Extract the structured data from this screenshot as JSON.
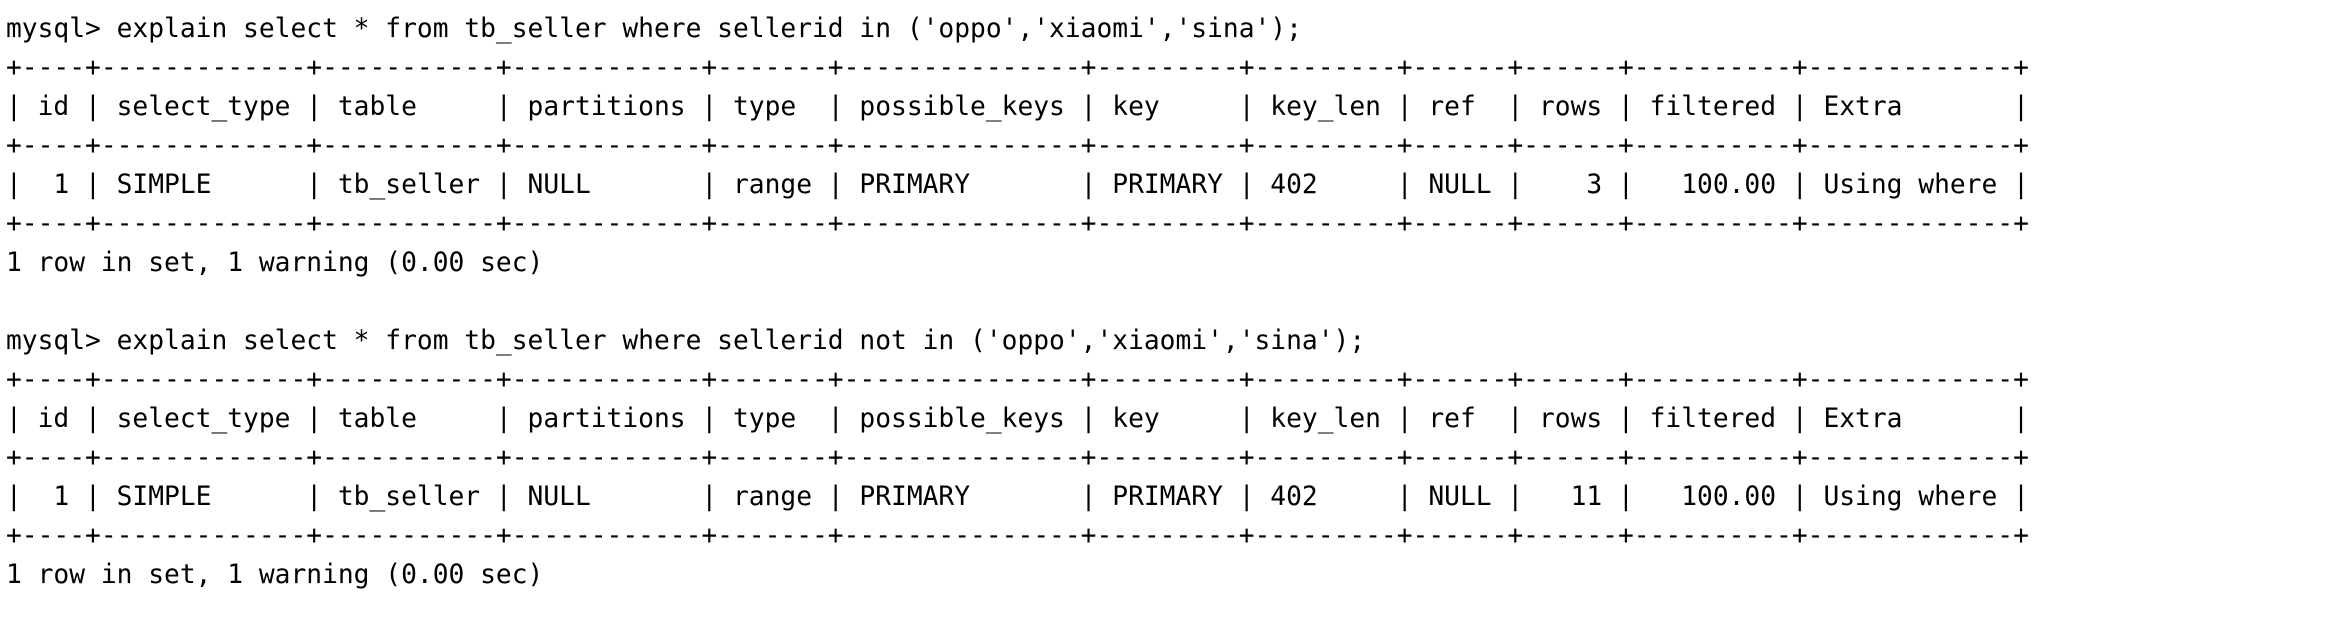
{
  "terminal": {
    "prompt": "mysql> ",
    "foreground_color": "#000000",
    "background_color": "#ffffff"
  },
  "statements": [
    {
      "prompt": "mysql> ",
      "query": "explain select * from tb_seller where sellerid in ('oppo','xiaomi','sina');",
      "command_line": "mysql> explain select * from tb_seller where sellerid in ('oppo','xiaomi','sina');",
      "border": "+----+-------------+-----------+------------+-------+---------------+---------+---------+------+------+----------+-------------+",
      "header_line": "| id | select_type | table     | partitions | type  | possible_keys | key     | key_len | ref  | rows | filtered | Extra       |",
      "row_line": "|  1 | SIMPLE      | tb_seller | NULL       | range | PRIMARY       | PRIMARY | 402     | NULL |    3 |   100.00 | Using where |",
      "status": "1 row in set, 1 warning (0.00 sec)",
      "columns": [
        "id",
        "select_type",
        "table",
        "partitions",
        "type",
        "possible_keys",
        "key",
        "key_len",
        "ref",
        "rows",
        "filtered",
        "Extra"
      ],
      "row": {
        "id": "1",
        "select_type": "SIMPLE",
        "table": "tb_seller",
        "partitions": "NULL",
        "type": "range",
        "possible_keys": "PRIMARY",
        "key": "PRIMARY",
        "key_len": "402",
        "ref": "NULL",
        "rows": "3",
        "filtered": "100.00",
        "Extra": "Using where"
      }
    },
    {
      "prompt": "mysql> ",
      "query": "explain select * from tb_seller where sellerid not in ('oppo','xiaomi','sina');",
      "command_line": "mysql> explain select * from tb_seller where sellerid not in ('oppo','xiaomi','sina');",
      "border": "+----+-------------+-----------+------------+-------+---------------+---------+---------+------+------+----------+-------------+",
      "header_line": "| id | select_type | table     | partitions | type  | possible_keys | key     | key_len | ref  | rows | filtered | Extra       |",
      "row_line": "|  1 | SIMPLE      | tb_seller | NULL       | range | PRIMARY       | PRIMARY | 402     | NULL |   11 |   100.00 | Using where |",
      "status": "1 row in set, 1 warning (0.00 sec)",
      "columns": [
        "id",
        "select_type",
        "table",
        "partitions",
        "type",
        "possible_keys",
        "key",
        "key_len",
        "ref",
        "rows",
        "filtered",
        "Extra"
      ],
      "row": {
        "id": "1",
        "select_type": "SIMPLE",
        "table": "tb_seller",
        "partitions": "NULL",
        "type": "range",
        "possible_keys": "PRIMARY",
        "key": "PRIMARY",
        "key_len": "402",
        "ref": "NULL",
        "rows": "11",
        "filtered": "100.00",
        "Extra": "Using where"
      }
    }
  ]
}
